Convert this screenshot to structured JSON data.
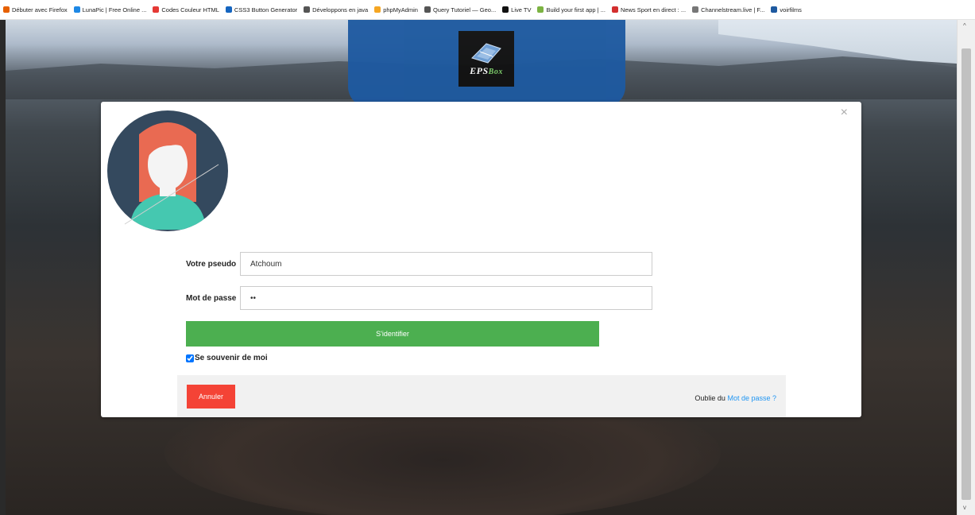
{
  "bookmarks": [
    {
      "label": "Débuter avec Firefox",
      "icon": "firefox-icon",
      "color": "#e66000"
    },
    {
      "label": "LunaPic | Free Online ...",
      "icon": "lunapic-icon",
      "color": "#1e88e5"
    },
    {
      "label": "Codes Couleur HTML",
      "icon": "opera-icon",
      "color": "#e53935"
    },
    {
      "label": "CSS3 Button Generator",
      "icon": "arrow-icon",
      "color": "#1565c0"
    },
    {
      "label": "Développons en java",
      "icon": "globe-icon",
      "color": "#555555"
    },
    {
      "label": "phpMyAdmin",
      "icon": "phpmyadmin-icon",
      "color": "#f5a623"
    },
    {
      "label": "Query Tutoriel — Geo...",
      "icon": "globe-icon",
      "color": "#555555"
    },
    {
      "label": "Live TV",
      "icon": "plus-icon",
      "color": "#111111"
    },
    {
      "label": "Build your first app | ...",
      "icon": "android-icon",
      "color": "#7cb342"
    },
    {
      "label": "News Sport en direct : ...",
      "icon": "news-icon",
      "color": "#d32f2f"
    },
    {
      "label": "Channelstream.live | F...",
      "icon": "stream-icon",
      "color": "#777777"
    },
    {
      "label": "voirfilms",
      "icon": "film-icon",
      "color": "#1e5aa0"
    }
  ],
  "logo": {
    "text_main": "EPS",
    "text_accent": "Box"
  },
  "modal": {
    "close_symbol": "×",
    "form": {
      "username_label": "Votre pseudo",
      "username_value": "Atchoum",
      "password_label": "Mot de passe",
      "password_value": "••",
      "submit_label": "S'identifier",
      "remember_label": "Se souvenir de moi",
      "remember_checked": true
    },
    "footer": {
      "cancel_label": "Annuler",
      "forgot_prefix": "Oublie du",
      "forgot_link": "Mot de passe ?"
    }
  },
  "scrollbar": {
    "up": "^",
    "down": "v"
  },
  "colors": {
    "submit": "#4caf50",
    "cancel": "#f44336",
    "link": "#2196f3",
    "logo_panel": "#1e5aa0"
  }
}
